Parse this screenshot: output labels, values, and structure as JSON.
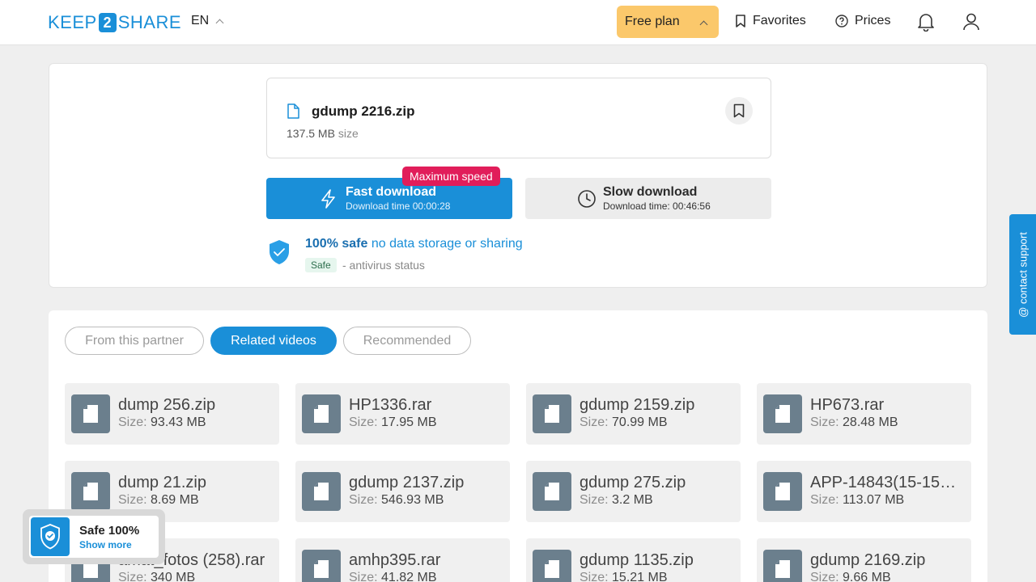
{
  "header": {
    "logo_left": "KEEP",
    "logo_mid": "2",
    "logo_right": "SHARE",
    "language": "EN",
    "plan_label": "Free plan",
    "favorites_label": "Favorites",
    "prices_label": "Prices"
  },
  "file": {
    "name": "gdump 2216.zip",
    "size_value": "137.5 MB",
    "size_label": "size"
  },
  "download": {
    "speed_badge": "Maximum speed",
    "fast_title": "Fast download",
    "fast_sub": "Download time 00:00:28",
    "slow_title": "Slow download",
    "slow_sub": "Download time: 00:46:56"
  },
  "safety": {
    "title_bold": "100% safe",
    "title_rest": "no data storage or sharing",
    "tag": "Safe",
    "note": "- antivirus status"
  },
  "tabs": [
    {
      "label": "From this partner",
      "active": false
    },
    {
      "label": "Related videos",
      "active": true
    },
    {
      "label": "Recommended",
      "active": false
    }
  ],
  "size_prefix": "Size:",
  "related_files": [
    {
      "name": "dump 256.zip",
      "size": "93.43 MB"
    },
    {
      "name": "HP1336.rar",
      "size": "17.95 MB"
    },
    {
      "name": "gdump 2159.zip",
      "size": "70.99 MB"
    },
    {
      "name": "HP673.rar",
      "size": "28.48 MB"
    },
    {
      "name": "dump 21.zip",
      "size": "8.69 MB"
    },
    {
      "name": "gdump 2137.zip",
      "size": "546.93 MB"
    },
    {
      "name": "gdump 275.zip",
      "size": "3.2 MB"
    },
    {
      "name": "APP-14843(15-15…",
      "size": "113.07 MB"
    },
    {
      "name": "amat_fotos (258).rar",
      "size": "340 MB"
    },
    {
      "name": "amhp395.rar",
      "size": "41.82 MB"
    },
    {
      "name": "gdump 1135.zip",
      "size": "15.21 MB"
    },
    {
      "name": "gdump 2169.zip",
      "size": "9.66 MB"
    }
  ],
  "contact_label": "@ contact support",
  "safe_popup": {
    "title": "Safe 100%",
    "link": "Show more"
  },
  "colors": {
    "accent": "#1a8fd8",
    "plan": "#fbc86b",
    "badge": "#e11d5a"
  }
}
